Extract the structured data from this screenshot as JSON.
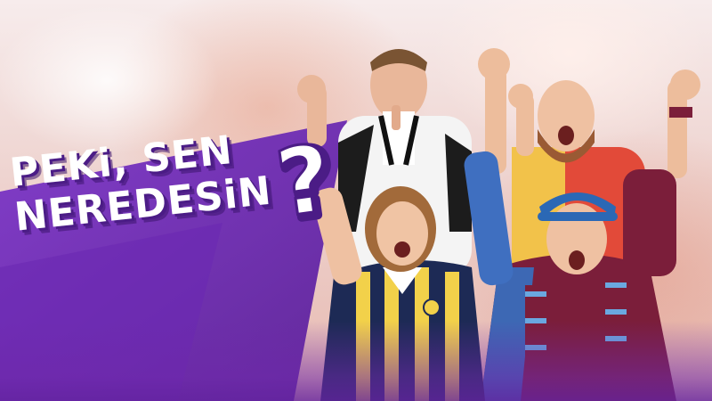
{
  "headline": {
    "line1": "PEKi, SEN",
    "line2": "NEREDESiN",
    "question_mark": "?"
  },
  "colors": {
    "purple": "#6f2bbf",
    "purple_dark": "#4b1c86",
    "headline_text": "#ffffff",
    "accent_red": "#e54b3c",
    "accent_yellow": "#f2c24a",
    "navy": "#1d2a55",
    "maroon": "#7b1e3a",
    "sky_blue": "#6aa8e0"
  },
  "scene": {
    "fans": [
      {
        "name": "fan-black-white-shirt"
      },
      {
        "name": "fan-yellow-navy-jersey"
      },
      {
        "name": "fan-red-yellow-jersey"
      },
      {
        "name": "fan-claret-blue-jersey"
      }
    ]
  }
}
